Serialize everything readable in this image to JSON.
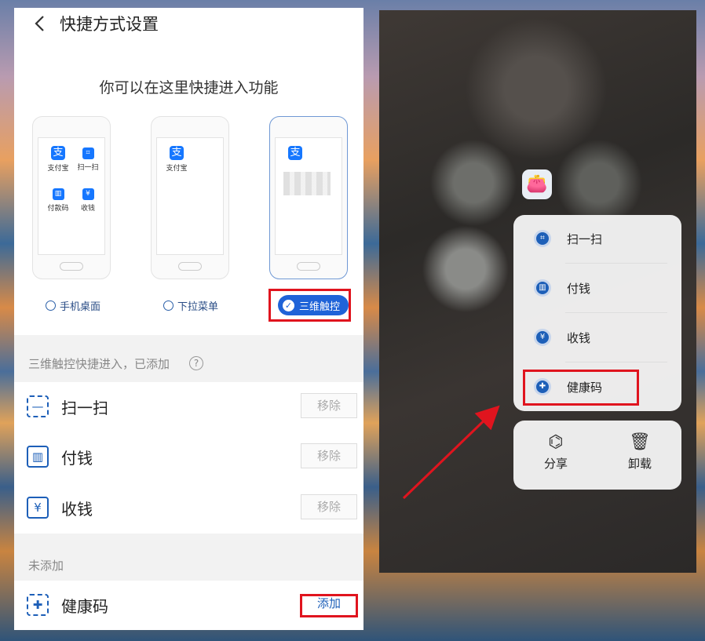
{
  "left": {
    "title": "快捷方式设置",
    "subtitle": "你可以在这里快捷进入功能",
    "modes": [
      {
        "label": "手机桌面",
        "selected": false,
        "tiles": [
          "支付宝",
          "扫一扫",
          "付款码",
          "收钱"
        ]
      },
      {
        "label": "下拉菜单",
        "selected": false,
        "tiles": [
          "支付宝"
        ]
      },
      {
        "label": "三维触控",
        "selected": true,
        "tiles": []
      }
    ],
    "added_section": {
      "label": "三维触控快捷进入，已添加",
      "items": [
        {
          "label": "扫一扫",
          "icon": "scan-icon",
          "button": "移除"
        },
        {
          "label": "付钱",
          "icon": "barcode-icon",
          "button": "移除"
        },
        {
          "label": "收钱",
          "icon": "yuan-icon",
          "button": "移除"
        }
      ]
    },
    "not_added_section": {
      "label": "未添加",
      "items": [
        {
          "label": "健康码",
          "icon": "health-code-icon",
          "button": "添加"
        }
      ]
    }
  },
  "right": {
    "menu": [
      {
        "label": "扫一扫",
        "icon": "scan-icon"
      },
      {
        "label": "付钱",
        "icon": "barcode-icon"
      },
      {
        "label": "收钱",
        "icon": "yuan-icon"
      },
      {
        "label": "健康码",
        "icon": "health-code-icon"
      }
    ],
    "actions": [
      {
        "label": "分享",
        "icon": "share-icon"
      },
      {
        "label": "卸载",
        "icon": "trash-icon"
      }
    ]
  },
  "colors": {
    "accent": "#1f63d8",
    "highlight": "#e0141e"
  }
}
